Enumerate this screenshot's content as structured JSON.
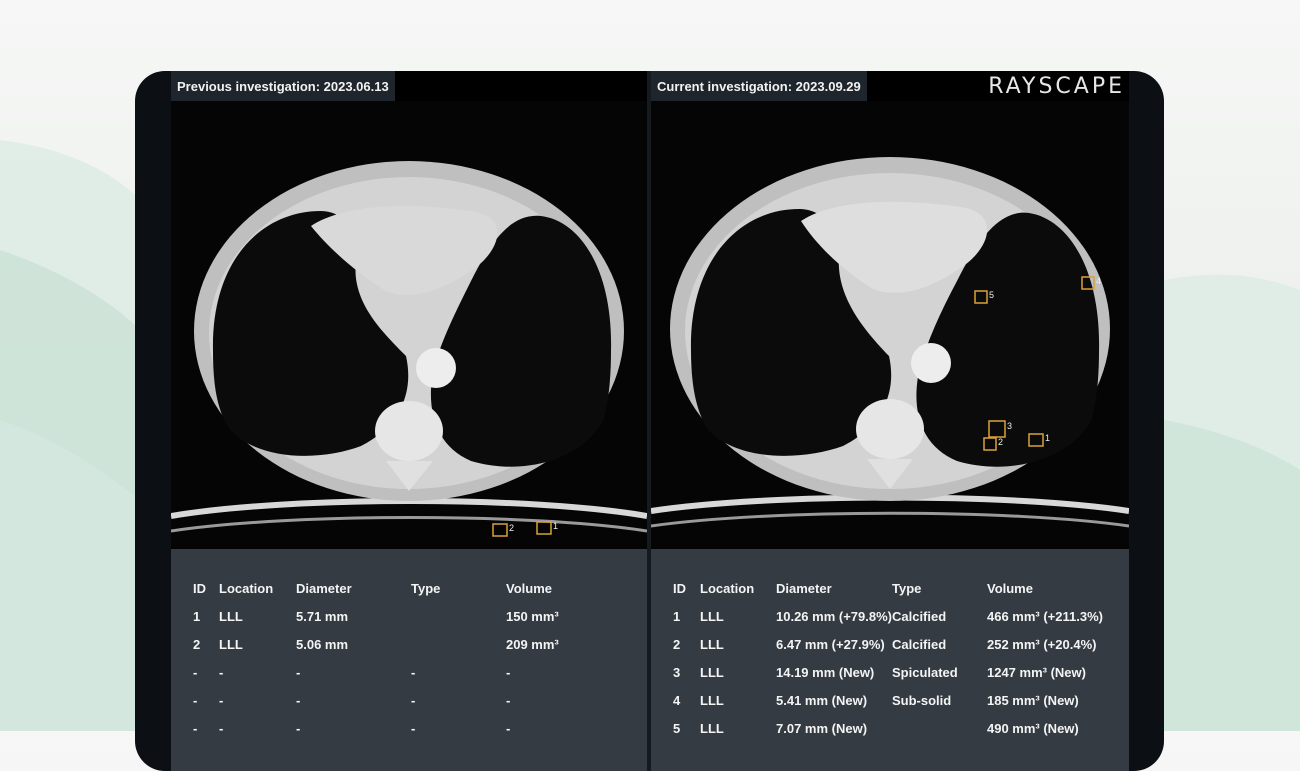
{
  "previous": {
    "header": "Previous investigation: 2023.06.13",
    "markers": [
      "2",
      "1"
    ],
    "columns": [
      "ID",
      "Location",
      "Diameter",
      "Type",
      "Volume"
    ],
    "rows": [
      [
        "1",
        "LLL",
        "5.71 mm",
        "",
        "150 mm³"
      ],
      [
        "2",
        "LLL",
        "5.06 mm",
        "",
        "209 mm³"
      ],
      [
        "-",
        "-",
        "-",
        "-",
        "-"
      ],
      [
        "-",
        "-",
        "-",
        "-",
        "-"
      ],
      [
        "-",
        "-",
        "-",
        "-",
        "-"
      ]
    ]
  },
  "current": {
    "header": "Current investigation: 2023.09.29",
    "logo": "RAYSCAPE",
    "markers": [
      "5",
      "4",
      "3",
      "2",
      "1"
    ],
    "columns": [
      "ID",
      "Location",
      "Diameter",
      "Type",
      "Volume"
    ],
    "rows": [
      [
        "1",
        "LLL",
        "10.26 mm (+79.8%)",
        "Calcified",
        "466 mm³ (+211.3%)"
      ],
      [
        "2",
        "LLL",
        "6.47 mm (+27.9%)",
        "Calcified",
        "252 mm³ (+20.4%)"
      ],
      [
        "3",
        "LLL",
        "14.19 mm (New)",
        "Spiculated",
        "1247 mm³ (New)"
      ],
      [
        "4",
        "LLL",
        "5.41 mm (New)",
        "Sub-solid",
        "185 mm³ (New)"
      ],
      [
        "5",
        "LLL",
        "7.07 mm (New)",
        "",
        "490 mm³ (New)"
      ]
    ]
  }
}
